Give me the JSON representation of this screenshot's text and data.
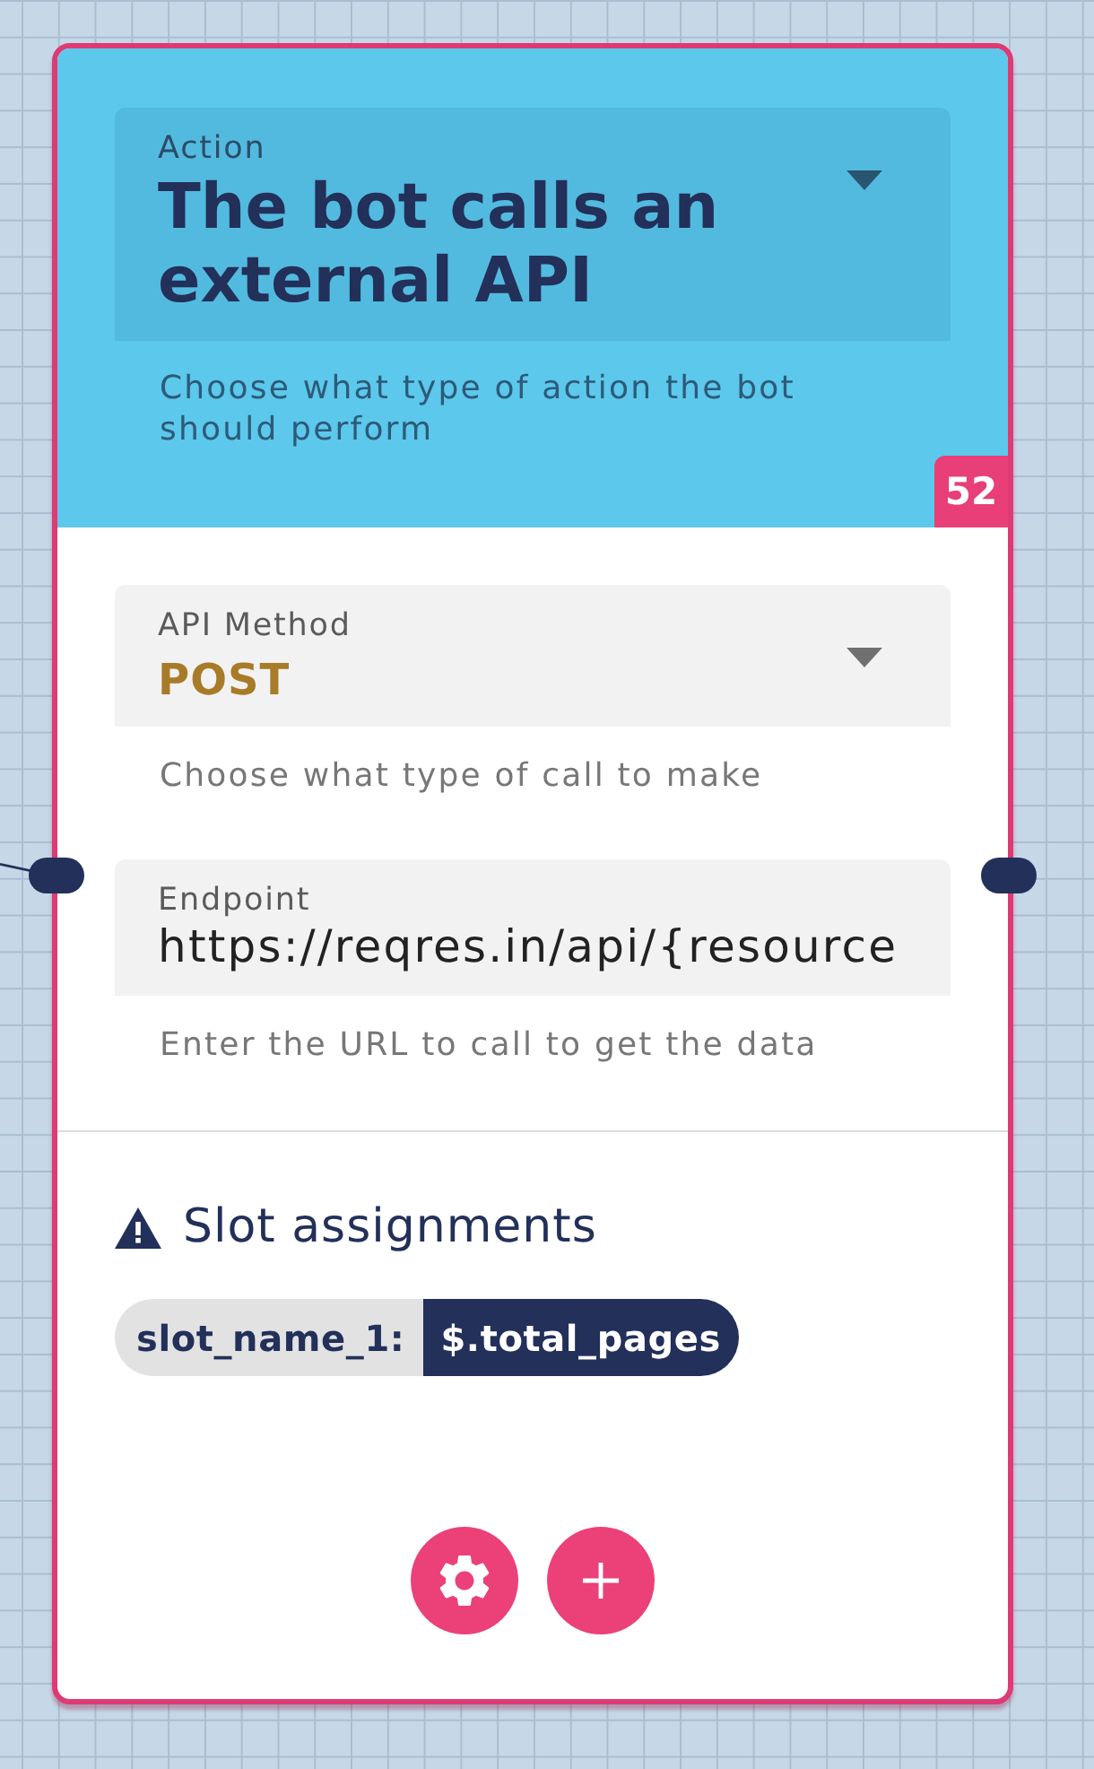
{
  "node": {
    "header": {
      "action_select": {
        "label": "Action",
        "value": "The bot calls an external API"
      },
      "helper": "Choose what type of action the bot should perform",
      "badge": "52"
    },
    "fields": [
      {
        "kind": "select",
        "label": "API Method",
        "value": "POST",
        "helper": "Choose what type of call to make"
      },
      {
        "kind": "text",
        "label": "Endpoint",
        "value": "https://reqres.in/api/{resource",
        "helper": "Enter the URL to call to get the data"
      }
    ],
    "slot_section": {
      "title": "Slot assignments",
      "warning": true,
      "assignments": [
        {
          "slot": "slot_name_1:",
          "value": "$.total_pages"
        }
      ]
    },
    "input_port": {
      "linked": true
    },
    "output_port": {
      "linked": false
    }
  }
}
